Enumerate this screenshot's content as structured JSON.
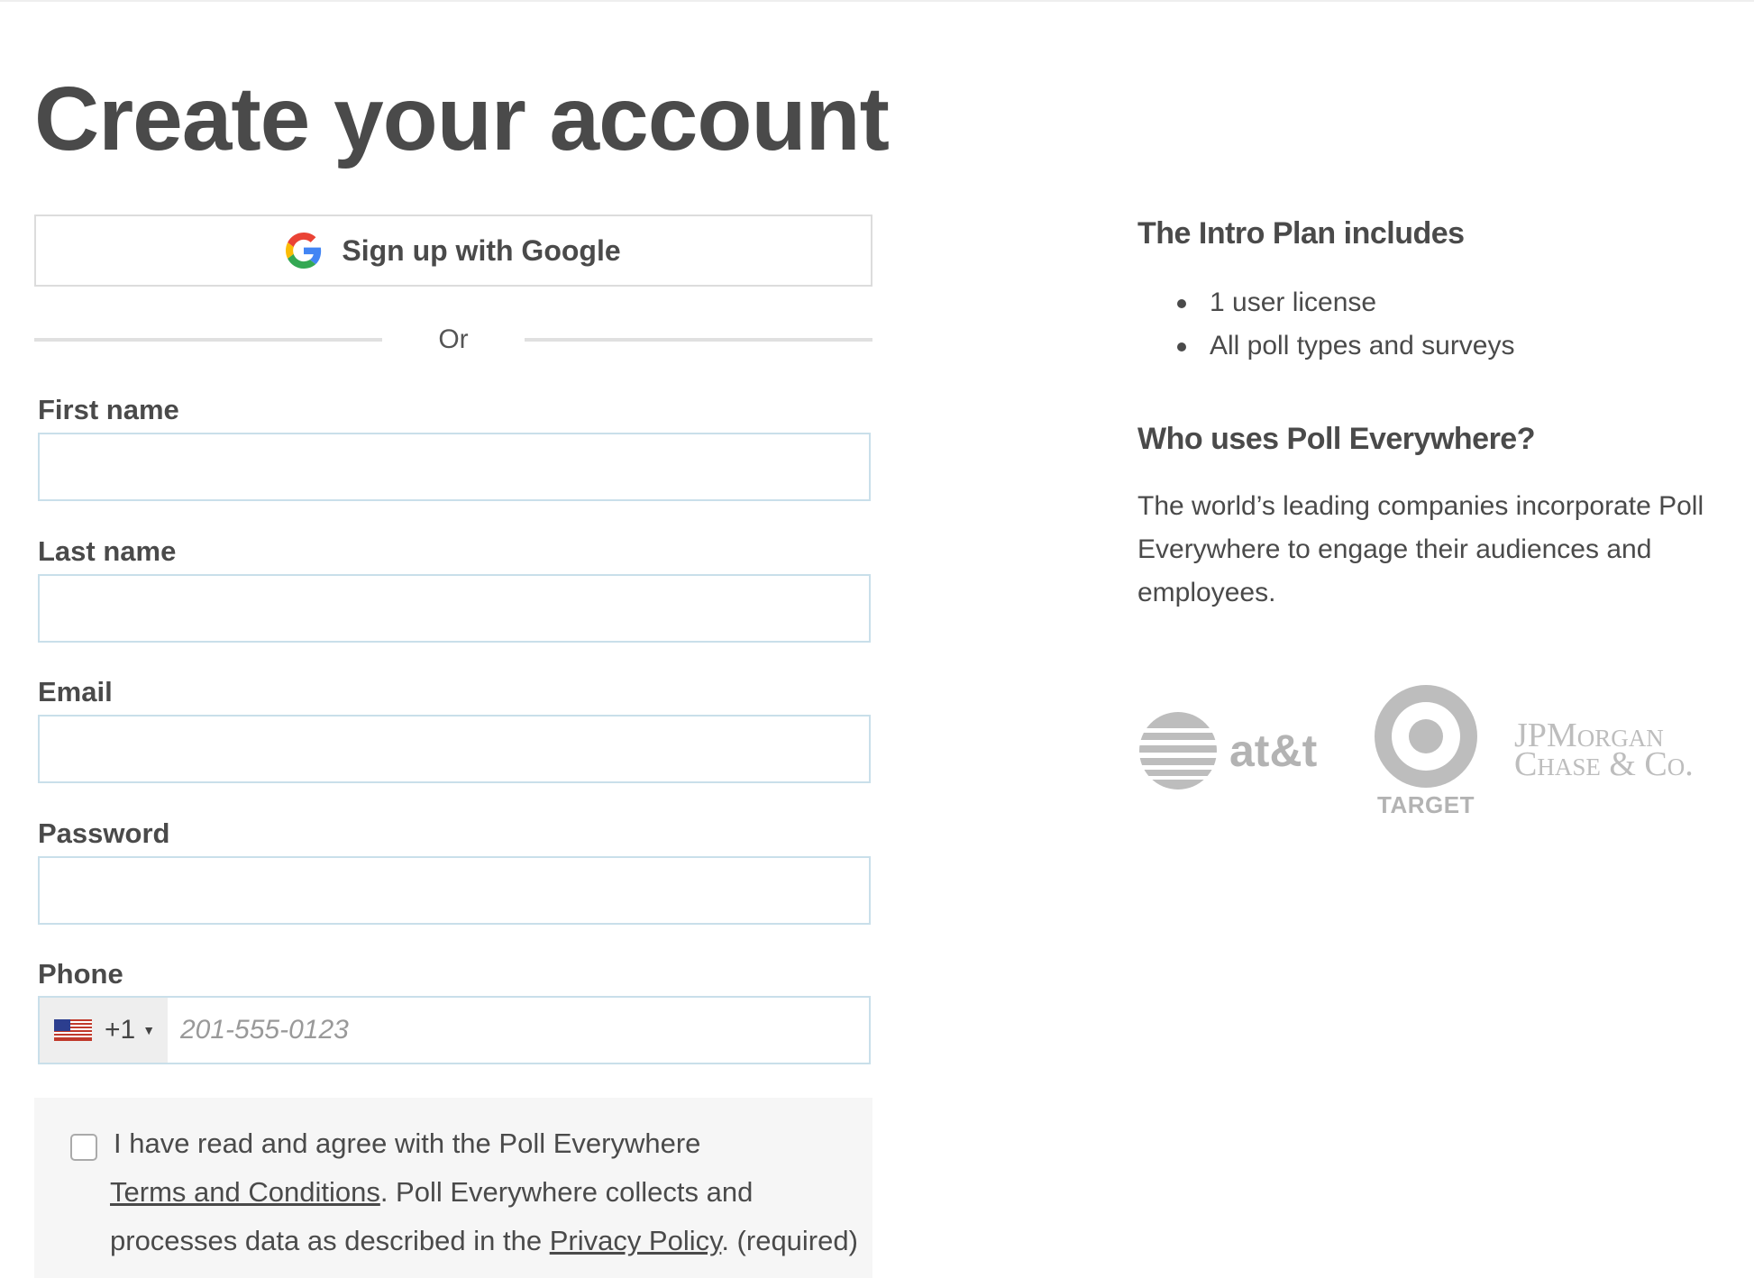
{
  "page": {
    "title": "Create your account"
  },
  "google_button": {
    "label": "Sign up with Google",
    "icon": "google-g-icon"
  },
  "divider": {
    "label": "Or"
  },
  "form": {
    "first_name": {
      "label": "First name",
      "value": ""
    },
    "last_name": {
      "label": "Last name",
      "value": ""
    },
    "email": {
      "label": "Email",
      "value": ""
    },
    "password": {
      "label": "Password",
      "value": ""
    },
    "phone": {
      "label": "Phone",
      "country_flag": "us-flag-icon",
      "dial_code": "+1",
      "placeholder": "201-555-0123",
      "value": ""
    }
  },
  "terms": {
    "checked": false,
    "line1": "I have read and agree with the Poll Everywhere",
    "terms_link": "Terms and Conditions",
    "line2_rest": ". Poll Everywhere collects and",
    "line3_pre": "processes data as described in the ",
    "privacy_link": "Privacy Policy",
    "line3_post": ". (required)"
  },
  "sidebar": {
    "plan_heading": "The Intro Plan includes",
    "plan_items": [
      "1 user license",
      "All poll types and surveys"
    ],
    "who_heading": "Who uses Poll Everywhere?",
    "who_text": "The world’s leading companies incorporate Poll Everywhere to engage their audiences and employees.",
    "logos": {
      "att": "at&t",
      "target": "TARGET",
      "jpmorgan_line1": "JPMorgan",
      "jpmorgan_line2": "Chase & Co."
    }
  },
  "colors": {
    "text": "#4a4a4a",
    "input_border": "#c9dfea",
    "logo_gray": "#b3b3b3",
    "terms_bg": "#f6f6f6"
  }
}
